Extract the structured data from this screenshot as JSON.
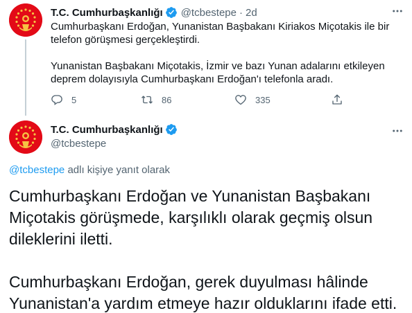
{
  "tweet1": {
    "name": "T.C. Cumhurbaşkanlığı",
    "handle": "@tcbestepe",
    "dot": "·",
    "time": "2d",
    "text_lines": [
      "Cumhurbaşkanı Erdoğan, Yunanistan Başbakanı Kiriakos Miçotakis ile bir",
      "telefon görüşmesi gerçekleştirdi.",
      "",
      "Yunanistan Başbakanı Miçotakis, İzmir ve bazı Yunan adalarını etkileyen",
      "deprem dolayısıyla Cumhurbaşkanı Erdoğan'ı telefonla aradı."
    ],
    "replies": "5",
    "retweets": "86",
    "likes": "335"
  },
  "tweet2": {
    "name": "T.C. Cumhurbaşkanlığı",
    "handle": "@tcbestepe",
    "replying_mention": "@tcbestepe",
    "replying_text": " adlı kişiye yanıt olarak",
    "body_lines": [
      "Cumhurbaşkanı Erdoğan ve Yunanistan Başbakanı",
      "Miçotakis görüşmede, karşılıklı olarak geçmiş olsun",
      "dileklerini iletti.",
      "",
      "Cumhurbaşkanı Erdoğan, gerek duyulması hâlinde",
      "Yunanistan'a yardım etmeye hazır olduklarını ifade etti."
    ]
  },
  "colors": {
    "text": "#0f1419",
    "secondary": "#536471",
    "accent": "#1d9bf0",
    "avatar_red": "#e30a17"
  },
  "icons": {
    "reply": "reply-icon",
    "retweet": "retweet-icon",
    "like": "heart-icon",
    "share": "share-icon",
    "more": "more-icon",
    "verified": "verified-badge-icon"
  }
}
